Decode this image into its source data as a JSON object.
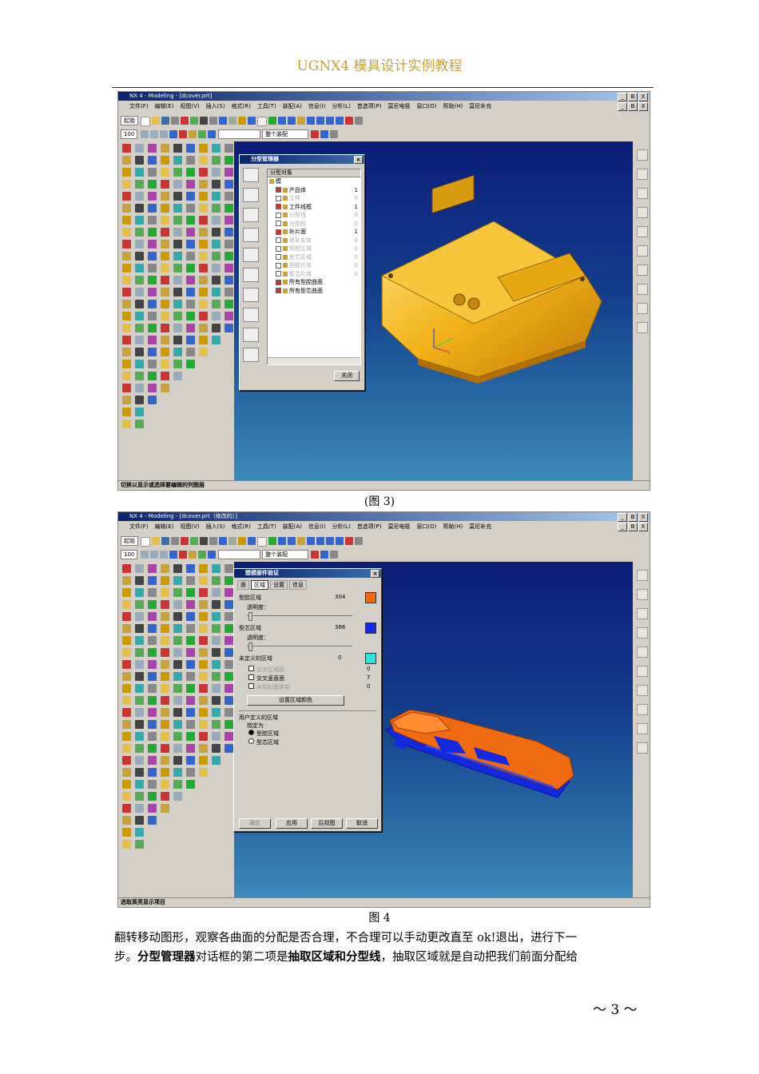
{
  "header": {
    "title": "UGNX4 模具设计实例教程"
  },
  "menu_items": [
    "文件(F)",
    "编辑(E)",
    "视图(V)",
    "插入(S)",
    "格式(R)",
    "工具(T)",
    "装配(A)",
    "信息(I)",
    "分析(L)",
    "首选项(P)",
    "莫尼电极",
    "窗口(O)",
    "帮助(H)",
    "莫尼补充"
  ],
  "toolbar": {
    "start": "起始",
    "zoom": "100",
    "filter": "整个装配"
  },
  "window_controls": [
    "_",
    "B",
    "X"
  ],
  "figure3": {
    "window_title": "NX 4 - Modeling - [dcover.prt]",
    "dialog_title": "分型管理器",
    "tree_header": "分型对象",
    "tree": [
      {
        "label": "模",
        "num": "",
        "dim": false
      },
      {
        "label": "产品体",
        "num": "1",
        "dim": false
      },
      {
        "label": "工件",
        "num": "0",
        "dim": true
      },
      {
        "label": "工件线框",
        "num": "1",
        "dim": false
      },
      {
        "label": "分型线",
        "num": "0",
        "dim": true
      },
      {
        "label": "分型段",
        "num": "0",
        "dim": true
      },
      {
        "label": "补片面",
        "num": "1",
        "dim": false
      },
      {
        "label": "修补实体",
        "num": "0",
        "dim": true
      },
      {
        "label": "型腔区域",
        "num": "0",
        "dim": true
      },
      {
        "label": "型芯区域",
        "num": "0",
        "dim": true
      },
      {
        "label": "型腔片体",
        "num": "0",
        "dim": true
      },
      {
        "label": "型芯片体",
        "num": "0",
        "dim": true
      },
      {
        "label": "所有型腔曲面",
        "num": "",
        "dim": false
      },
      {
        "label": "所有型芯曲面",
        "num": "",
        "dim": false
      }
    ],
    "close_button": "关闭",
    "status_text": "切换以显示或选择要编辑的列图层",
    "caption": "(图 3)"
  },
  "figure4": {
    "window_title": "NX 4 - Modeling - [dcover.prt（修改的）]",
    "dialog_title": "塑模部件验证",
    "tabs": [
      "面",
      "区域",
      "设置",
      "信息"
    ],
    "cavity_label": "型腔区域",
    "cavity_count": "304",
    "core_label": "型芯区域",
    "core_count": "366",
    "transparency_label": "透明度：",
    "undefined_label": "未定义的区域",
    "undefined_count": "0",
    "undef_items": [
      {
        "label": "交叉区域面",
        "num": "0"
      },
      {
        "label": "交叉竖直面",
        "num": "7"
      },
      {
        "label": "未知的面类型",
        "num": "0"
      }
    ],
    "set_color_button": "设置区域颜色",
    "user_defined_label": "用户定义的区域",
    "assign_label": "指定为",
    "radio_cavity": "型腔区域",
    "radio_core": "型芯区域",
    "buttons": [
      "确定",
      "应用",
      "后视图",
      "取消"
    ],
    "status_text": "选取高亮显示项目",
    "caption": "图 4",
    "colors": {
      "cavity": "#f06a10",
      "core": "#1428e0",
      "undefined": "#30e0e0"
    }
  },
  "body_text": {
    "line1": "翻转移动图形，观察各曲面的分配是否合理，不合理可以手动更改直至 ok!退出，进行下一",
    "line2_a": "步。",
    "line2_b": "分型管理器",
    "line2_c": "对话框的第二项是",
    "line2_d": "抽取区域和分型线",
    "line2_e": "，抽取区域就是自动把我们前面分配给"
  },
  "page_number": "～ 3 ～"
}
